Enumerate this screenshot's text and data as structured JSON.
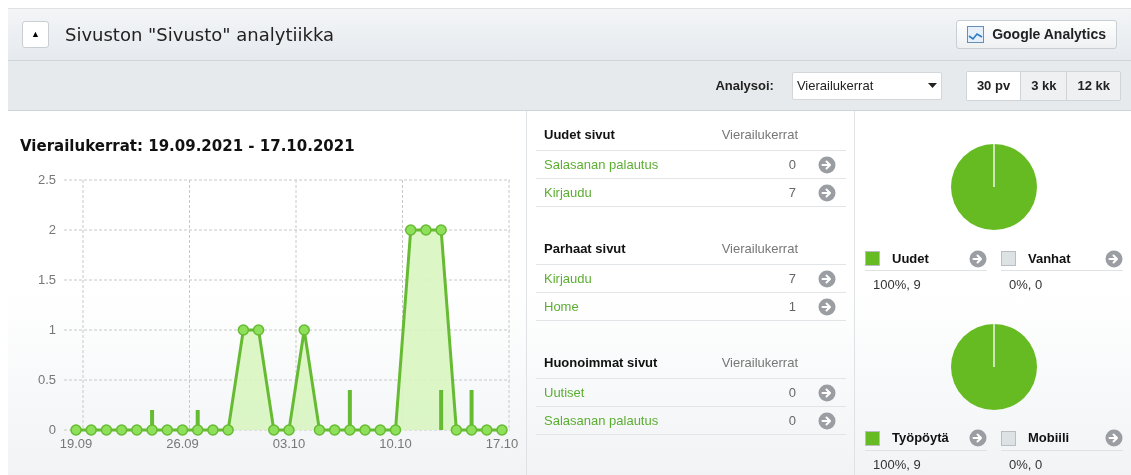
{
  "header": {
    "collapse_symbol": "▲",
    "title": "Sivuston \"Sivusto\" analytiikka",
    "ga_button": "Google Analytics"
  },
  "toolbar": {
    "analyze_label": "Analysoi:",
    "select_value": "Vierailukerrat",
    "periods": [
      {
        "label": "30 pv",
        "selected": true
      },
      {
        "label": "3 kk",
        "selected": false
      },
      {
        "label": "12 kk",
        "selected": false
      }
    ]
  },
  "visits_chart": {
    "title": "Vierailukerrat: 19.09.2021 - 17.10.2021",
    "chart_data": {
      "type": "area",
      "categories": [
        "19.09",
        null,
        null,
        null,
        null,
        null,
        null,
        "26.09",
        null,
        null,
        null,
        null,
        null,
        null,
        "03.10",
        null,
        null,
        null,
        null,
        null,
        null,
        "10.10",
        null,
        null,
        null,
        null,
        null,
        null,
        "17.10"
      ],
      "grid": true,
      "values": [
        0,
        0,
        0,
        0,
        0,
        0,
        0,
        0,
        0,
        0,
        0,
        1,
        1,
        0,
        0,
        1,
        0,
        0,
        0,
        0,
        0,
        0,
        2,
        2,
        2,
        0,
        0,
        0,
        0
      ],
      "ylim": [
        0,
        2.5
      ],
      "yticks": [
        0,
        0.5,
        1,
        1.5,
        2,
        2.5
      ]
    },
    "day_markers": [
      {
        "kind": "none"
      },
      {
        "kind": "none"
      },
      {
        "kind": "none"
      },
      {
        "kind": "none"
      },
      {
        "kind": "none"
      },
      {
        "kind": "short"
      },
      {
        "kind": "none"
      },
      {
        "kind": "none"
      },
      {
        "kind": "short"
      },
      {
        "kind": "none"
      },
      {
        "kind": "none"
      },
      {
        "kind": "none"
      },
      {
        "kind": "none"
      },
      {
        "kind": "none"
      },
      {
        "kind": "none"
      },
      {
        "kind": "none"
      },
      {
        "kind": "none"
      },
      {
        "kind": "none"
      },
      {
        "kind": "tall"
      },
      {
        "kind": "none"
      },
      {
        "kind": "none"
      },
      {
        "kind": "none"
      },
      {
        "kind": "none"
      },
      {
        "kind": "none"
      },
      {
        "kind": "tall"
      },
      {
        "kind": "none"
      },
      {
        "kind": "tall"
      },
      {
        "kind": "none"
      },
      {
        "kind": "none"
      }
    ]
  },
  "page_tables": [
    {
      "heading": "Uudet sivut",
      "column": "Vierailukerrat",
      "rows": [
        {
          "page": "Salasanan palautus",
          "count": "0"
        },
        {
          "page": "Kirjaudu",
          "count": "7"
        }
      ]
    },
    {
      "heading": "Parhaat sivut",
      "column": "Vierailukerrat",
      "rows": [
        {
          "page": "Kirjaudu",
          "count": "7"
        },
        {
          "page": "Home",
          "count": "1"
        }
      ]
    },
    {
      "heading": "Huonoimmat sivut",
      "column": "Vierailukerrat",
      "rows": [
        {
          "page": "Uutiset",
          "count": "0"
        },
        {
          "page": "Salasanan palautus",
          "count": "0"
        }
      ]
    }
  ],
  "pies": [
    {
      "chart_data": {
        "type": "pie",
        "categories": [
          "Uudet",
          "Vanhat"
        ],
        "values": [
          100,
          0
        ],
        "needle": "Uudet"
      },
      "legend": [
        {
          "value": "100%, 9",
          "color": "#66bb22"
        },
        {
          "value": "0%, 0",
          "color": "#dde2e4"
        }
      ]
    },
    {
      "chart_data": {
        "type": "pie",
        "categories": [
          "Työpöytä",
          "Mobiili"
        ],
        "values": [
          100,
          0
        ],
        "needle": "Työpöytä"
      },
      "legend": [
        {
          "value": "100%, 9",
          "color": "#66bb22"
        },
        {
          "value": "0%, 0",
          "color": "#dde2e4"
        }
      ]
    }
  ]
}
